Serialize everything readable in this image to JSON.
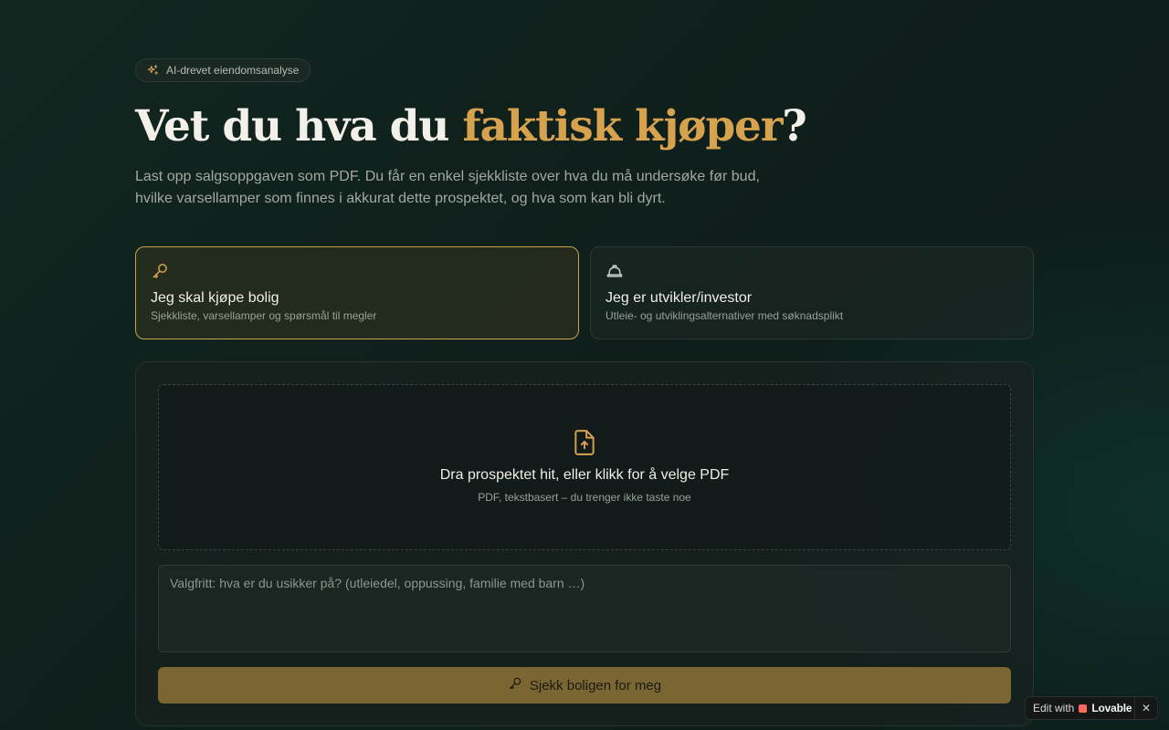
{
  "badge": {
    "icon": "sparkles-icon",
    "label": "AI-drevet eiendomsanalyse"
  },
  "hero": {
    "title_prefix": "Vet du hva du ",
    "title_accent": "faktisk kjøper",
    "title_suffix": "?",
    "lead_line1": "Last opp salgsoppgaven som PDF. Du får en enkel sjekkliste over hva du må undersøke før bud,",
    "lead_line2": "hvilke varsellamper som finnes i akkurat dette prospektet, og hva som kan bli dyrt."
  },
  "modes": [
    {
      "icon": "key-icon",
      "title": "Jeg skal kjøpe bolig",
      "subtitle": "Sjekkliste, varsellamper og spørsmål til megler",
      "selected": true
    },
    {
      "icon": "hard-hat-icon",
      "title": "Jeg er utvikler/investor",
      "subtitle": "Utleie- og utviklingsalternativer med søknadsplikt",
      "selected": false
    }
  ],
  "upload": {
    "icon": "file-upload-icon",
    "title": "Dra prospektet hit, eller klikk for å velge PDF",
    "subtitle": "PDF, tekstbasert – du trenger ikke taste noe"
  },
  "notes": {
    "value": "",
    "placeholder": "Valgfritt: hva er du usikker på? (utleiedel, oppussing, familie med barn …)"
  },
  "submit": {
    "icon": "key-icon",
    "label": "Sjekk boligen for meg"
  },
  "lovable": {
    "edit_label": "Edit with",
    "brand": "Lovable",
    "close_icon": "close-icon"
  },
  "colors": {
    "accent": "#d6a24e",
    "active_border": "#c9a54a",
    "button": "#7a6632",
    "background": "#0f1f1b"
  }
}
